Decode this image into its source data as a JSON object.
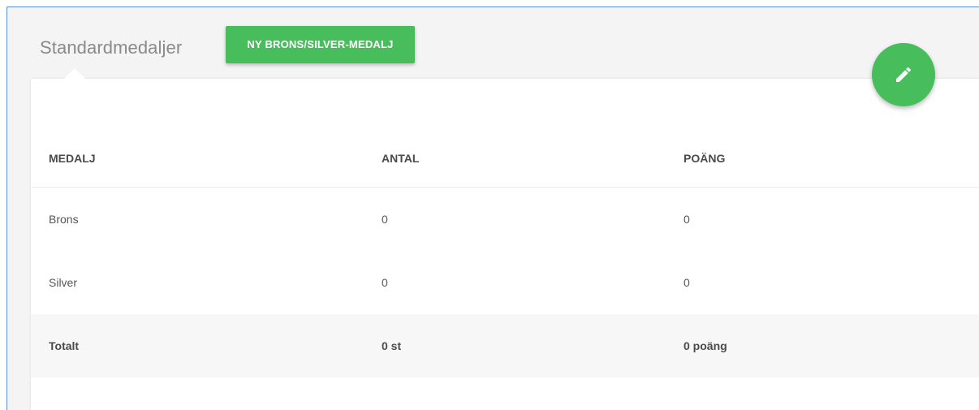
{
  "header": {
    "title": "Standardmedaljer",
    "new_button_label": "NY BRONS/SILVER-MEDALJ",
    "edit_icon": "pencil-icon"
  },
  "colors": {
    "accent": "#47bd5c",
    "title_text": "#8a8a8a",
    "frame_border": "#5b8fd6"
  },
  "table": {
    "columns": [
      "MEDALJ",
      "ANTAL",
      "POÄNG"
    ],
    "rows": [
      {
        "medal": "Brons",
        "count": "0",
        "points": "0"
      },
      {
        "medal": "Silver",
        "count": "0",
        "points": "0"
      }
    ],
    "total": {
      "label": "Totalt",
      "count": "0 st",
      "points": "0 poäng"
    }
  }
}
